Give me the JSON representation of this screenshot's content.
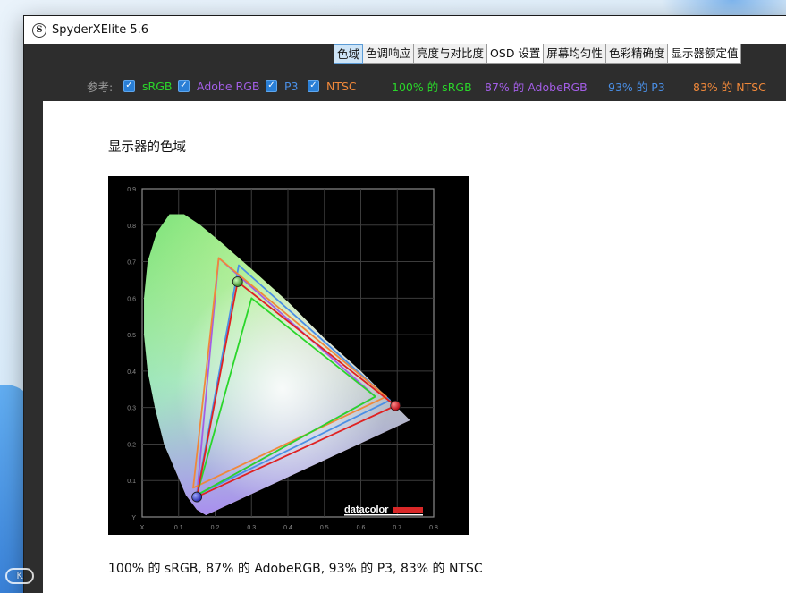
{
  "window": {
    "title": "SpyderXElite 5.6",
    "icon_glyph": "S"
  },
  "tabs": [
    {
      "label": "色域",
      "active": true
    },
    {
      "label": "色调响应"
    },
    {
      "label": "亮度与对比度"
    },
    {
      "label": "OSD 设置"
    },
    {
      "label": "屏幕均匀性"
    },
    {
      "label": "色彩精确度"
    },
    {
      "label": "显示器额定值"
    }
  ],
  "reference": {
    "label": "参考:",
    "items": [
      {
        "label": "sRGB",
        "checked": true,
        "color": "#2ad62a"
      },
      {
        "label": "Adobe RGB",
        "checked": true,
        "color": "#a35ee6"
      },
      {
        "label": "P3",
        "checked": true,
        "color": "#4a8fe6"
      },
      {
        "label": "NTSC",
        "checked": true,
        "color": "#f0883a"
      }
    ],
    "stats": [
      {
        "text": "100% 的 sRGB",
        "color": "#2ad62a"
      },
      {
        "text": "87% 的 AdobeRGB",
        "color": "#a35ee6"
      },
      {
        "text": "93% 的 P3",
        "color": "#4a8fe6"
      },
      {
        "text": "83% 的 NTSC",
        "color": "#f0883a"
      }
    ]
  },
  "main": {
    "section_title": "显示器的色域",
    "summary": "100% 的 sRGB, 87% 的 AdobeRGB, 93% 的 P3, 83% 的 NTSC"
  },
  "chart_data": {
    "type": "scatter",
    "title": "",
    "xlabel": "X",
    "ylabel": "Y",
    "xlim": [
      0,
      0.8
    ],
    "ylim": [
      0,
      0.9
    ],
    "x_ticks": [
      "X",
      "0.1",
      "0.2",
      "0.3",
      "0.4",
      "0.5",
      "0.6",
      "0.7",
      "0.8"
    ],
    "y_ticks": [
      "Y",
      "0.1",
      "0.2",
      "0.3",
      "0.4",
      "0.5",
      "0.6",
      "0.7",
      "0.8",
      "0.9"
    ],
    "grid": true,
    "logo": "datacolor",
    "series": [
      {
        "name": "Adobe RGB",
        "color": "#a35ee6",
        "points": [
          [
            0.64,
            0.33
          ],
          [
            0.21,
            0.71
          ],
          [
            0.15,
            0.06
          ]
        ]
      },
      {
        "name": "P3",
        "color": "#4a8fe6",
        "points": [
          [
            0.68,
            0.32
          ],
          [
            0.265,
            0.69
          ],
          [
            0.15,
            0.06
          ]
        ]
      },
      {
        "name": "NTSC",
        "color": "#f0883a",
        "points": [
          [
            0.67,
            0.33
          ],
          [
            0.21,
            0.71
          ],
          [
            0.14,
            0.08
          ]
        ]
      },
      {
        "name": "sRGB",
        "color": "#2ad62a",
        "points": [
          [
            0.64,
            0.33
          ],
          [
            0.3,
            0.6
          ],
          [
            0.15,
            0.06
          ]
        ]
      },
      {
        "name": "",
        "color": "#e02222",
        "points": [
          [
            0.695,
            0.305
          ],
          [
            0.262,
            0.645
          ],
          [
            0.15,
            0.055
          ]
        ],
        "markers": true
      }
    ],
    "locus": [
      [
        0.175,
        0.005
      ],
      [
        0.15,
        0.02
      ],
      [
        0.12,
        0.06
      ],
      [
        0.09,
        0.13
      ],
      [
        0.06,
        0.2
      ],
      [
        0.035,
        0.3
      ],
      [
        0.015,
        0.4
      ],
      [
        0.005,
        0.5
      ],
      [
        0.005,
        0.6
      ],
      [
        0.015,
        0.7
      ],
      [
        0.04,
        0.78
      ],
      [
        0.075,
        0.83
      ],
      [
        0.115,
        0.83
      ],
      [
        0.16,
        0.8
      ],
      [
        0.22,
        0.75
      ],
      [
        0.3,
        0.68
      ],
      [
        0.4,
        0.59
      ],
      [
        0.5,
        0.49
      ],
      [
        0.6,
        0.4
      ],
      [
        0.7,
        0.3
      ],
      [
        0.735,
        0.265
      ]
    ]
  }
}
